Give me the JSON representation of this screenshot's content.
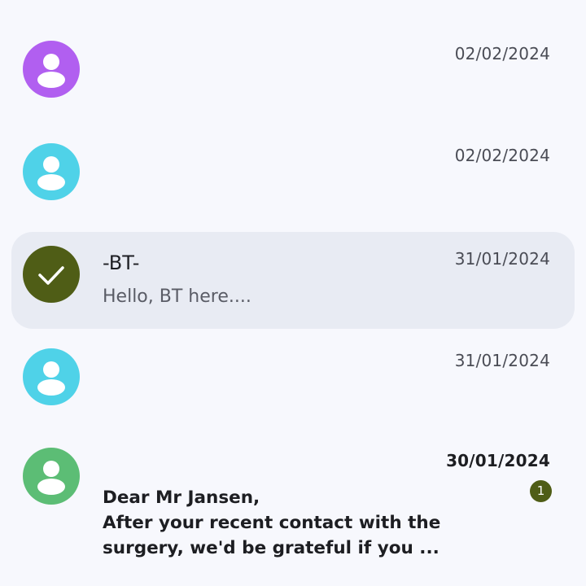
{
  "conversations": [
    {
      "name": "",
      "snippet": "",
      "date": "02/02/2024",
      "avatar_color": "#b15ff0",
      "selected": false,
      "unread": false
    },
    {
      "name": "",
      "snippet": "",
      "date": "02/02/2024",
      "avatar_color": "#4fd2e8",
      "selected": false,
      "unread": false
    },
    {
      "name": "-BT-",
      "snippet": "Hello, BT here....",
      "date": "31/01/2024",
      "avatar_color": "#4f5d16",
      "avatar_icon": "checkmark-icon",
      "selected": true,
      "unread": false
    },
    {
      "name": "",
      "snippet": "",
      "date": "31/01/2024",
      "avatar_color": "#4fd2e8",
      "selected": false,
      "unread": false
    },
    {
      "name": "",
      "snippet": "Dear Mr Jansen,\nAfter your recent contact with the surgery, we'd be grateful if you ...",
      "date": "30/01/2024",
      "unread_count": "1",
      "avatar_color": "#5cbd75",
      "selected": false,
      "unread": true
    }
  ],
  "colors": {
    "background": "#f7f8fd",
    "selected_row": "#e8ebf3",
    "badge": "#4f5d16"
  }
}
